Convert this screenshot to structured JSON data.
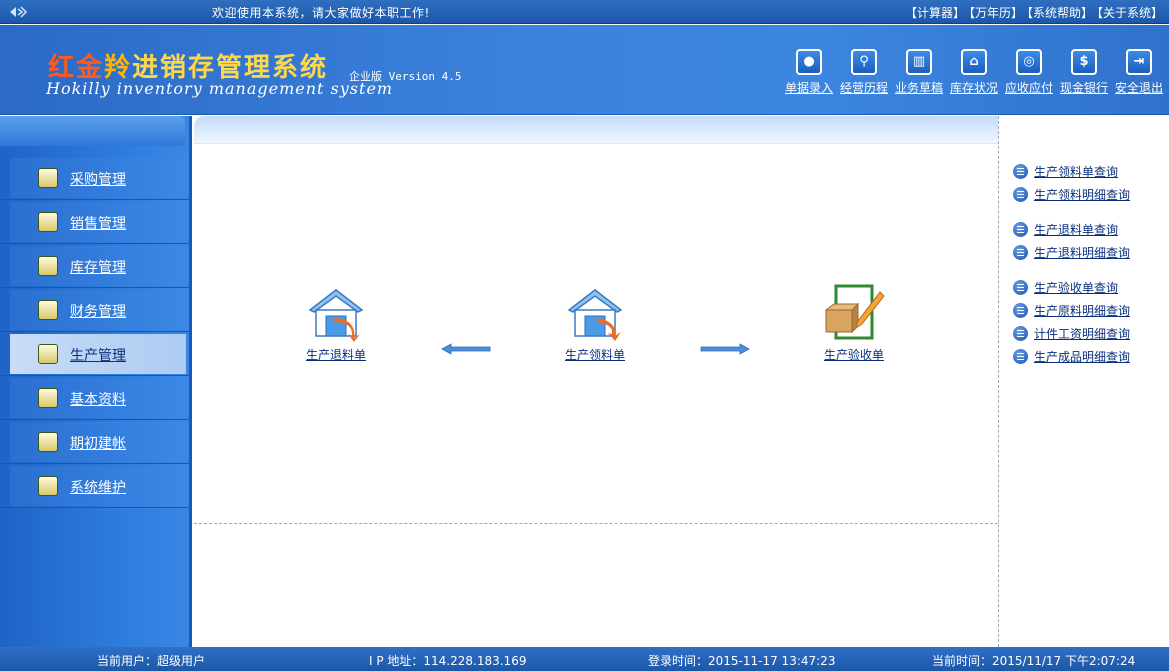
{
  "topbar": {
    "welcome": "欢迎使用本系统，请大家做好本职工作!",
    "links": [
      "【计算器】",
      "【万年历】",
      "【系统帮助】",
      "【关于系统】"
    ]
  },
  "header": {
    "logo_part1": "红金",
    "logo_part2": "羚",
    "logo_part3": "进销存管理系统",
    "subtitle": "Hokilly inventory management system",
    "edition": "企业版 Version 4.5"
  },
  "toolbar": {
    "items": [
      {
        "label": "单据录入",
        "icon": "person-icon"
      },
      {
        "label": "经营历程",
        "icon": "magnifier-icon"
      },
      {
        "label": "业务草稿",
        "icon": "trash-icon"
      },
      {
        "label": "库存状况",
        "icon": "home-icon"
      },
      {
        "label": "应收应付",
        "icon": "coin-icon"
      },
      {
        "label": "现金银行",
        "icon": "dollar-icon"
      },
      {
        "label": "安全退出",
        "icon": "exit-icon"
      }
    ]
  },
  "sidebar": {
    "items": [
      {
        "label": "采购管理",
        "icon": "purchase-icon"
      },
      {
        "label": "销售管理",
        "icon": "sales-icon"
      },
      {
        "label": "库存管理",
        "icon": "inventory-icon"
      },
      {
        "label": "财务管理",
        "icon": "finance-icon"
      },
      {
        "label": "生产管理",
        "icon": "production-icon",
        "active": true
      },
      {
        "label": "基本资料",
        "icon": "basic-data-icon"
      },
      {
        "label": "期初建帐",
        "icon": "windows-icon"
      },
      {
        "label": "系统维护",
        "icon": "maintenance-icon"
      }
    ]
  },
  "flow": {
    "return": "生产退料单",
    "issue": "生产领料单",
    "receipt": "生产验收单"
  },
  "right_panel": {
    "groups": [
      [
        "生产领料单查询",
        "生产领料明细查询"
      ],
      [
        "生产退料单查询",
        "生产退料明细查询"
      ],
      [
        "生产验收单查询",
        "生产原料明细查询",
        "计件工资明细查询",
        "生产成品明细查询"
      ]
    ]
  },
  "status": {
    "user": "当前用户：超级用户",
    "ip": "I P 地址：114.228.183.169",
    "login": "登录时间：2015-11-17 13:47:23",
    "now": "当前时间：2015/11/17 下午2:07:24"
  },
  "colors": {
    "primary_blue": "#2b6ac7",
    "link_navy": "#0a2f7a",
    "logo_red": "#ff5a1e",
    "logo_gold": "#ffb400"
  }
}
